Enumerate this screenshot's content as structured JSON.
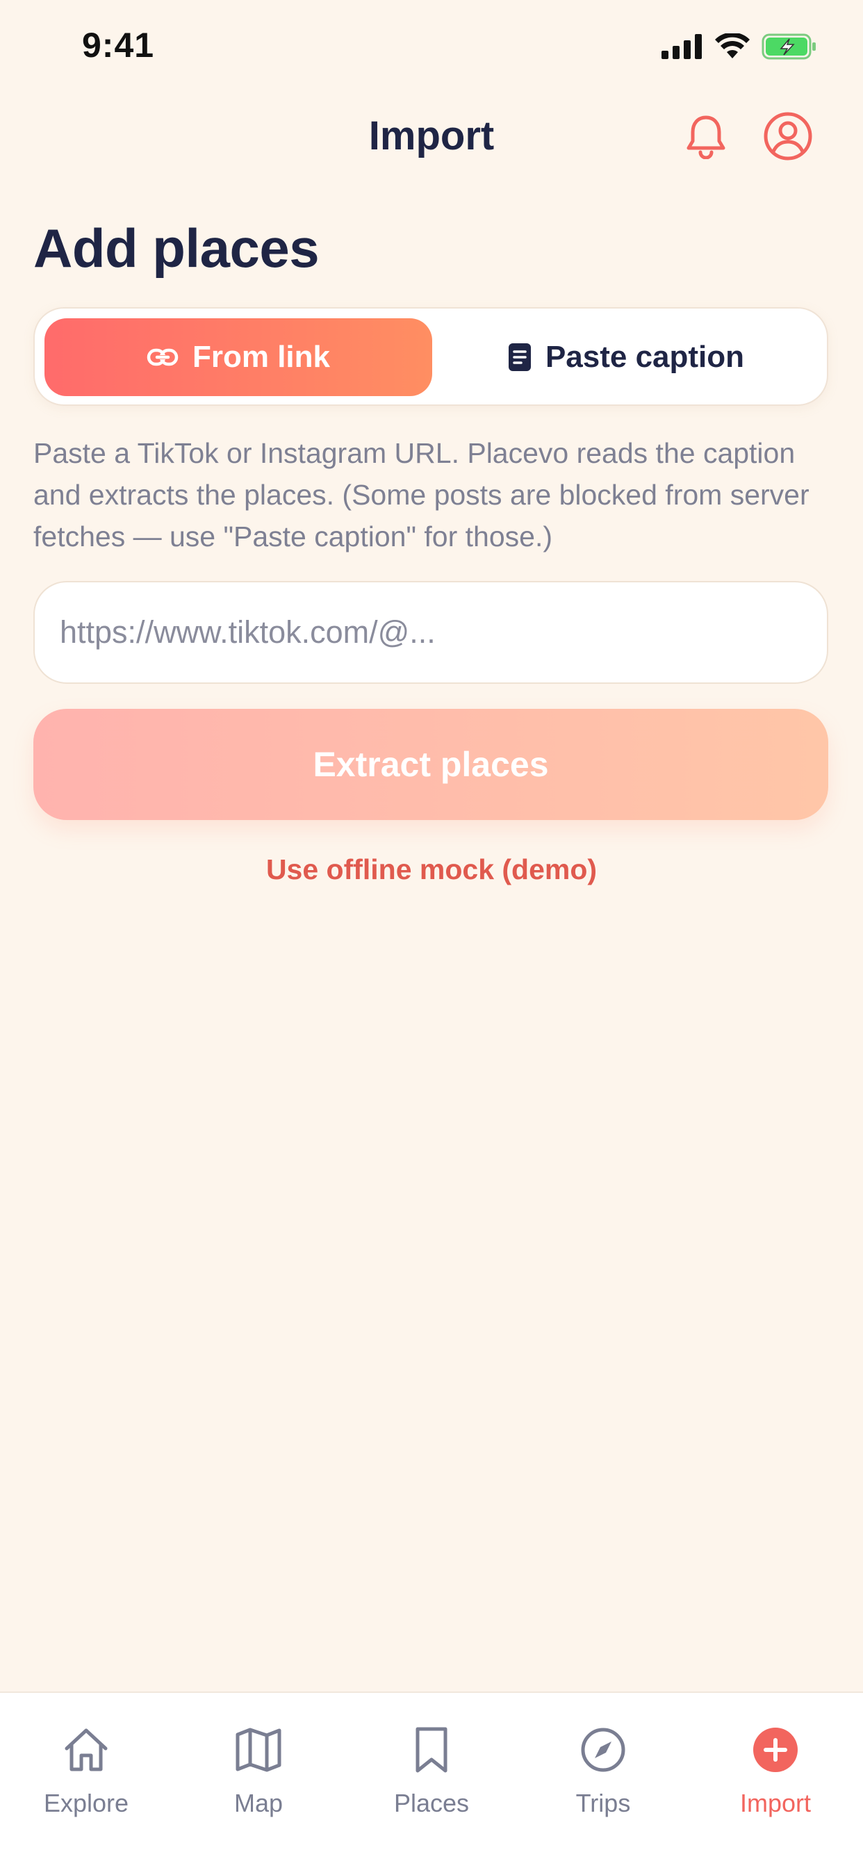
{
  "status_bar": {
    "time": "9:41"
  },
  "header": {
    "title": "Import"
  },
  "page": {
    "title": "Add places"
  },
  "segmented": {
    "options": [
      {
        "label": "From link",
        "icon": "link-icon",
        "selected": true
      },
      {
        "label": "Paste caption",
        "icon": "document-icon",
        "selected": false
      }
    ]
  },
  "helper_text": "Paste a TikTok or Instagram URL. Placevo reads the caption and extracts the places. (Some posts are blocked from server fetches — use \"Paste caption\" for those.)",
  "url_input": {
    "placeholder": "https://www.tiktok.com/@...",
    "value": ""
  },
  "extract_button": {
    "label": "Extract places"
  },
  "mock_link": {
    "label": "Use offline mock (demo)"
  },
  "tabs": [
    {
      "label": "Explore",
      "icon": "home-icon",
      "active": false
    },
    {
      "label": "Map",
      "icon": "map-icon",
      "active": false
    },
    {
      "label": "Places",
      "icon": "bookmark-icon",
      "active": false
    },
    {
      "label": "Trips",
      "icon": "compass-icon",
      "active": false
    },
    {
      "label": "Import",
      "icon": "plus-circle-icon",
      "active": true
    }
  ],
  "colors": {
    "background": "#FDF5EC",
    "accent": "#FF6B6B",
    "accent_end": "#FF8E62",
    "text_dark": "#1F2545",
    "text_muted": "#7E8093",
    "link_red": "#E05A4E"
  }
}
